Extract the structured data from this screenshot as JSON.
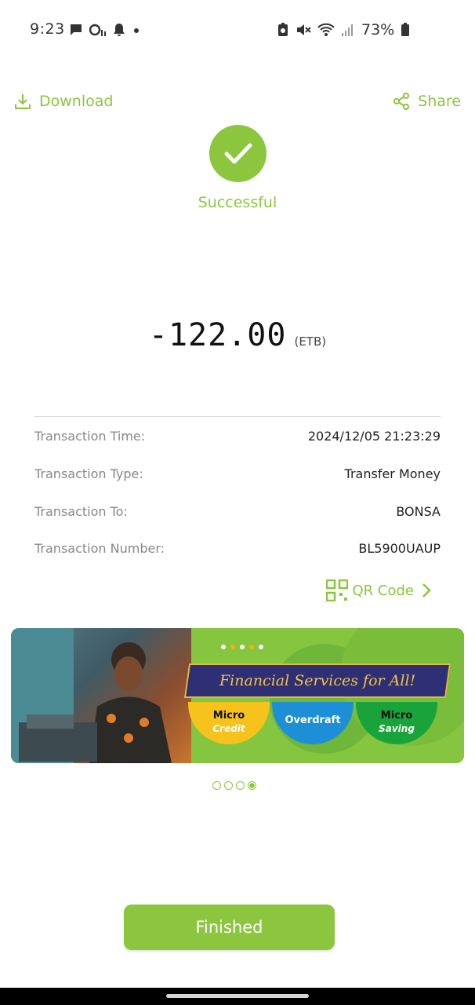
{
  "status_bar": {
    "time": "9:23",
    "battery": "73%",
    "left_icons": [
      "message-icon",
      "tty-icon",
      "bell-icon",
      "dot-icon"
    ],
    "right_icons": [
      "battery-saver-icon",
      "mute-icon",
      "wifi-icon",
      "signal-icon",
      "battery-icon"
    ]
  },
  "actions": {
    "download": "Download",
    "share": "Share"
  },
  "result": {
    "status": "Successful",
    "amount": "-122.00",
    "currency": "(ETB)"
  },
  "details": [
    {
      "label": "Transaction Time:",
      "value": "2024/12/05 21:23:29"
    },
    {
      "label": "Transaction Type:",
      "value": "Transfer Money"
    },
    {
      "label": "Transaction To:",
      "value": "BONSA"
    },
    {
      "label": "Transaction Number:",
      "value": "BL5900UAUP"
    }
  ],
  "qr": {
    "label": "QR Code"
  },
  "banner": {
    "title": "Financial Services for All!",
    "items": [
      {
        "title": "Micro",
        "sub": "Credit"
      },
      {
        "title": "Overdraft",
        "sub": ""
      },
      {
        "title": "Micro",
        "sub": "Saving"
      }
    ],
    "pages": 4,
    "active_page": 4
  },
  "footer": {
    "finished": "Finished"
  },
  "colors": {
    "accent": "#8cc63f"
  }
}
